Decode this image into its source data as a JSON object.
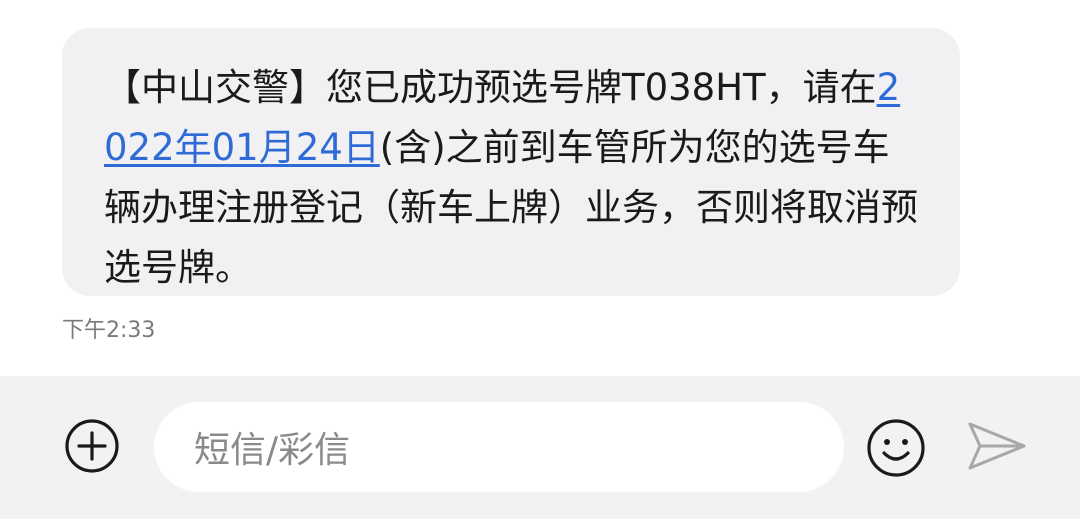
{
  "message": {
    "text_part1": "【中山交警】您已成功预选号牌T038HT，请在",
    "date_link": "2022年01月24日",
    "text_part2": "(含)之前到车管所为您的选号车辆办理注册登记（新车上牌）业务，否则将取消预选号牌。",
    "timestamp": "下午2:33"
  },
  "composer": {
    "placeholder": "短信/彩信",
    "attach_icon": "plus-circle-icon",
    "emoji_icon": "smiley-icon",
    "send_icon": "send-arrow-icon"
  },
  "colors": {
    "bubble_bg": "#f1f1f3",
    "link": "#2f6bd6",
    "bar_bg": "#f2f2f4",
    "icon_dark": "#1a1a1a",
    "icon_disabled": "#a8a8a8"
  }
}
